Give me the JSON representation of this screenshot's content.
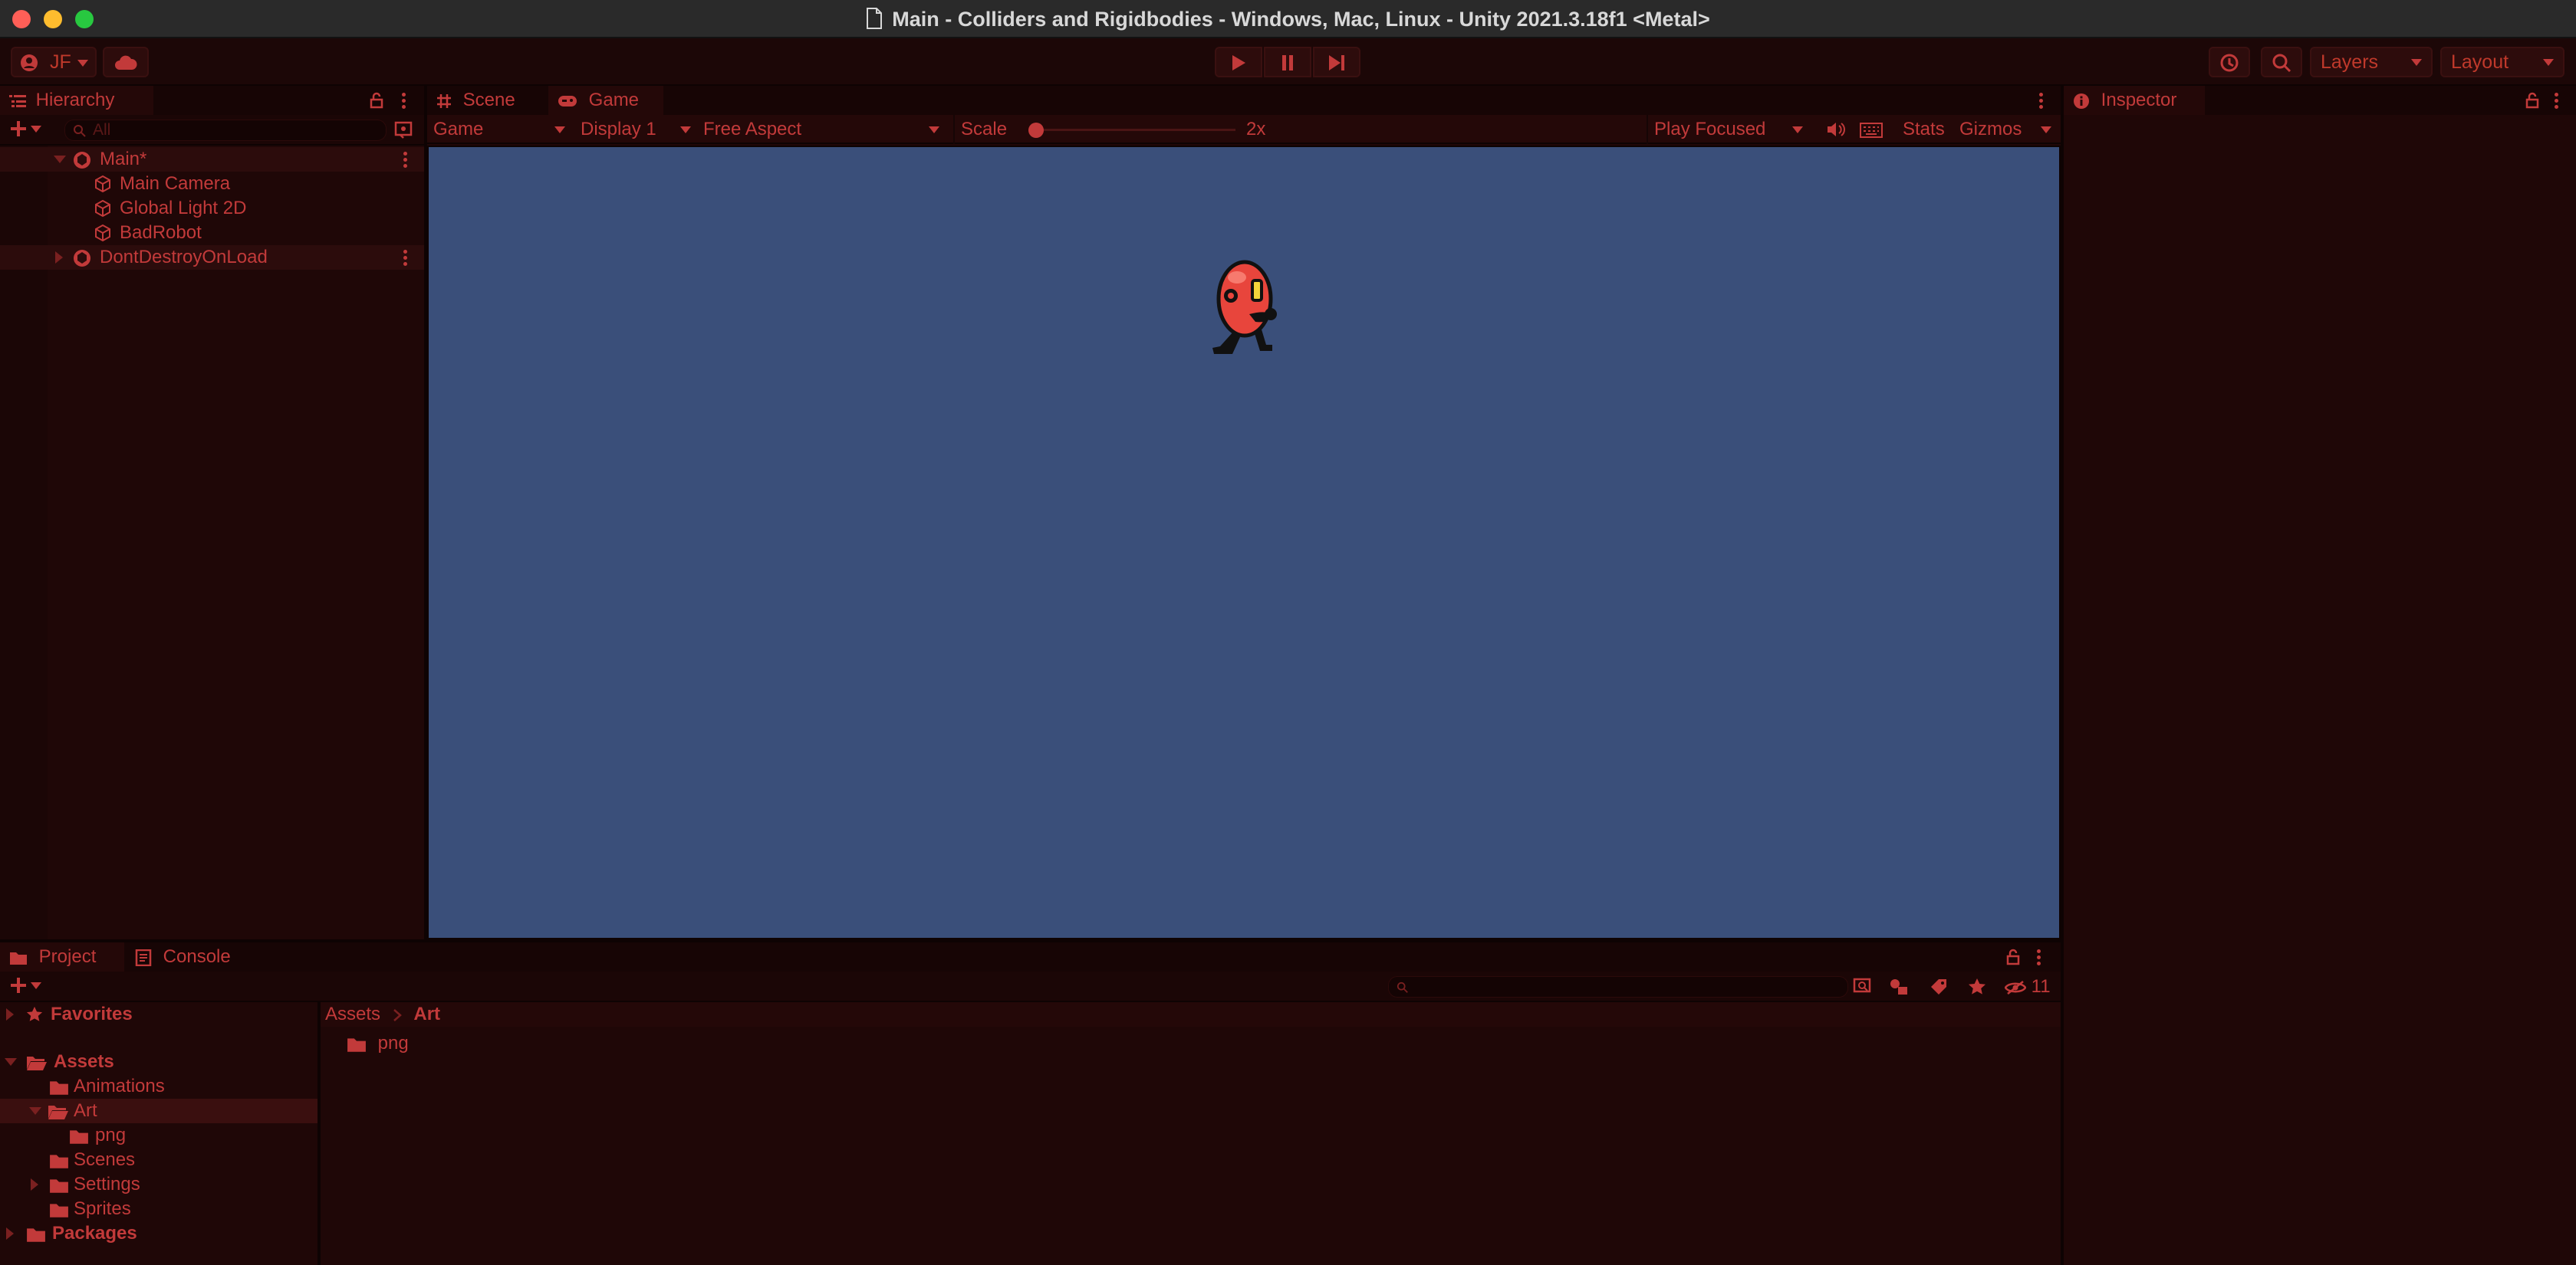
{
  "window": {
    "title": "Main - Colliders and Rigidbodies - Windows, Mac, Linux - Unity 2021.3.18f1 <Metal>"
  },
  "toolbar": {
    "account_label": "JF",
    "layers_label": "Layers",
    "layout_label": "Layout"
  },
  "hierarchy": {
    "tab_label": "Hierarchy",
    "search_placeholder": "All",
    "items": [
      {
        "label": "Main*",
        "kind": "scene",
        "expanded": true
      },
      {
        "label": "Main Camera",
        "kind": "gameobject"
      },
      {
        "label": "Global Light 2D",
        "kind": "gameobject"
      },
      {
        "label": "BadRobot",
        "kind": "gameobject"
      },
      {
        "label": "DontDestroyOnLoad",
        "kind": "scene",
        "expanded": false
      }
    ]
  },
  "center": {
    "tabs": [
      {
        "label": "Scene",
        "icon": "grid-icon",
        "active": false
      },
      {
        "label": "Game",
        "icon": "gamepad-icon",
        "active": true
      }
    ],
    "game_view_label": "Game",
    "display_label": "Display 1",
    "aspect_label": "Free Aspect",
    "scale_label": "Scale",
    "scale_value": "2x",
    "scale_fraction": 0.0,
    "play_mode_label": "Play Focused",
    "stats_label": "Stats",
    "gizmos_label": "Gizmos",
    "background_color": "#3a4f7a"
  },
  "inspector": {
    "tab_label": "Inspector"
  },
  "project": {
    "tabs": [
      {
        "label": "Project",
        "active": true
      },
      {
        "label": "Console",
        "active": false
      }
    ],
    "hidden_count": "11",
    "tree": [
      {
        "label": "Favorites",
        "level": 0,
        "icon": "star-icon",
        "caret": "right"
      },
      {
        "label": "Assets",
        "level": 0,
        "icon": "folder-open-icon",
        "caret": "down"
      },
      {
        "label": "Animations",
        "level": 1,
        "icon": "folder-icon",
        "caret": "none"
      },
      {
        "label": "Art",
        "level": 1,
        "icon": "folder-open-icon",
        "caret": "down",
        "selected": true
      },
      {
        "label": "png",
        "level": 2,
        "icon": "folder-icon",
        "caret": "none"
      },
      {
        "label": "Scenes",
        "level": 1,
        "icon": "folder-icon",
        "caret": "none"
      },
      {
        "label": "Settings",
        "level": 1,
        "icon": "folder-icon",
        "caret": "right"
      },
      {
        "label": "Sprites",
        "level": 1,
        "icon": "folder-icon",
        "caret": "none"
      },
      {
        "label": "Packages",
        "level": 0,
        "icon": "folder-icon",
        "caret": "right"
      }
    ],
    "breadcrumb": [
      "Assets",
      "Art"
    ],
    "content": [
      {
        "label": "png",
        "icon": "folder-icon"
      }
    ]
  },
  "colors": {
    "accent_red": "#c23a3a",
    "panel_bg": "#1f0707",
    "game_bg": "#3a4f7a"
  }
}
